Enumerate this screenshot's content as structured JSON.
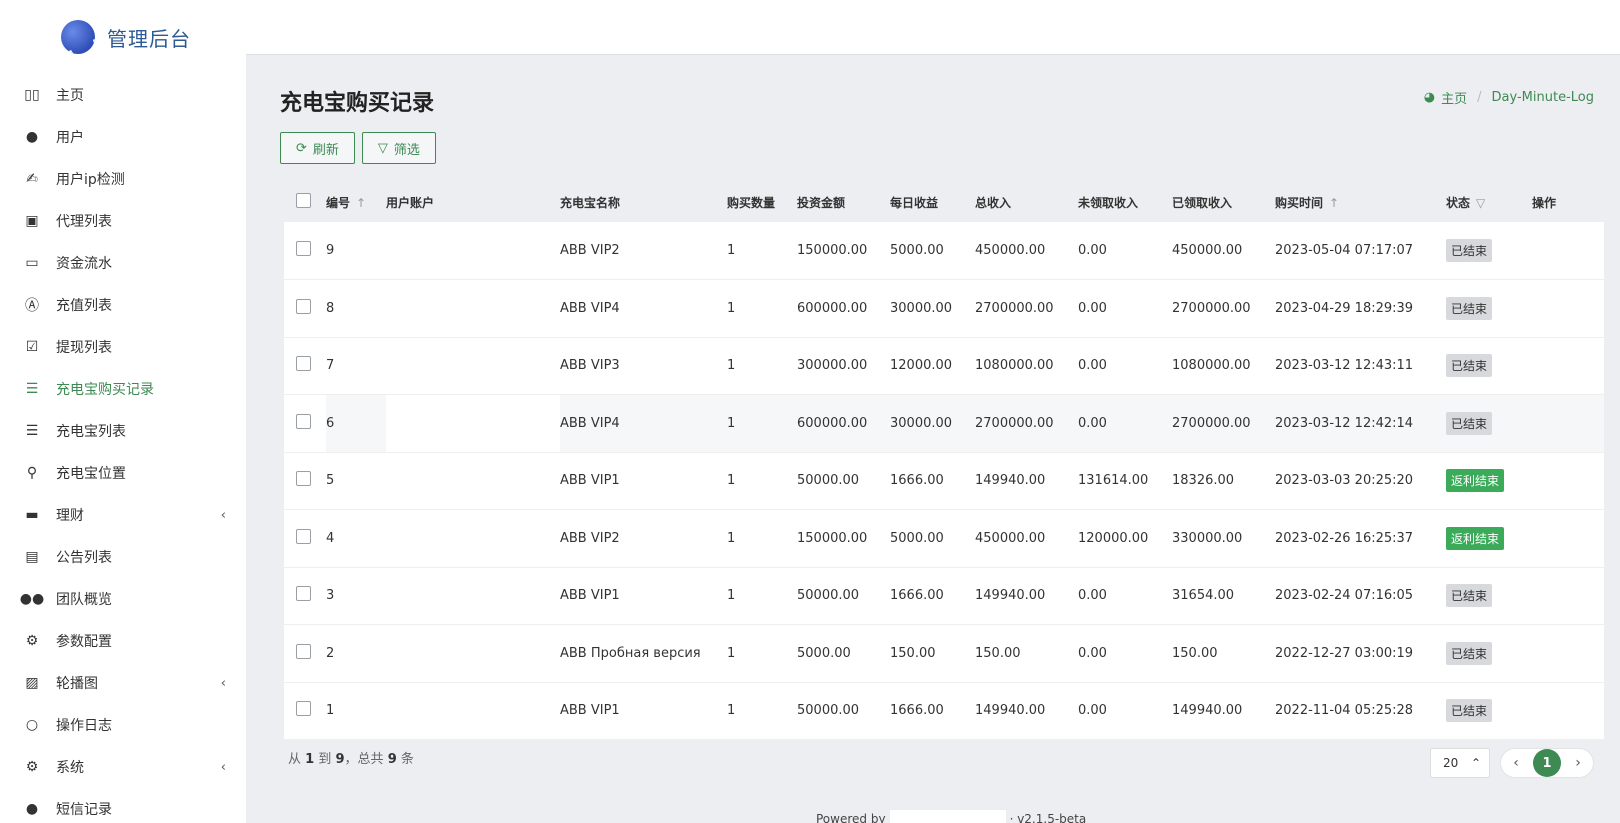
{
  "brand": {
    "title": "管理后台"
  },
  "sidebar": {
    "items": [
      {
        "label": "主页",
        "icon": "bar-chart-icon",
        "glyph": "▯▯",
        "active": false,
        "chevron": false
      },
      {
        "label": "用户",
        "icon": "user-icon",
        "glyph": "●",
        "active": false,
        "chevron": false
      },
      {
        "label": "用户ip检测",
        "icon": "signature-icon",
        "glyph": "✍",
        "active": false,
        "chevron": false
      },
      {
        "label": "代理列表",
        "icon": "contact-book-icon",
        "glyph": "▣",
        "active": false,
        "chevron": false
      },
      {
        "label": "资金流水",
        "icon": "money-icon",
        "glyph": "▭",
        "active": false,
        "chevron": false
      },
      {
        "label": "充值列表",
        "icon": "letter-a-icon",
        "glyph": "Ⓐ",
        "active": false,
        "chevron": false
      },
      {
        "label": "提现列表",
        "icon": "check-square-icon",
        "glyph": "☑",
        "active": false,
        "chevron": false
      },
      {
        "label": "充电宝购买记录",
        "icon": "list-icon",
        "glyph": "☰",
        "active": true,
        "chevron": false
      },
      {
        "label": "充电宝列表",
        "icon": "indent-icon",
        "glyph": "☰",
        "active": false,
        "chevron": false
      },
      {
        "label": "充电宝位置",
        "icon": "map-marker-icon",
        "glyph": "⚲",
        "active": false,
        "chevron": false
      },
      {
        "label": "理财",
        "icon": "archive-icon",
        "glyph": "▬",
        "active": false,
        "chevron": true
      },
      {
        "label": "公告列表",
        "icon": "file-text-icon",
        "glyph": "▤",
        "active": false,
        "chevron": false
      },
      {
        "label": "团队概览",
        "icon": "users-icon",
        "glyph": "●●",
        "active": false,
        "chevron": false
      },
      {
        "label": "参数配置",
        "icon": "cogs-icon",
        "glyph": "⚙",
        "active": false,
        "chevron": false
      },
      {
        "label": "轮播图",
        "icon": "image-icon",
        "glyph": "▨",
        "active": false,
        "chevron": true
      },
      {
        "label": "操作日志",
        "icon": "circle-icon",
        "glyph": "○",
        "active": false,
        "chevron": false
      },
      {
        "label": "系统",
        "icon": "gear-icon",
        "glyph": "⚙",
        "active": false,
        "chevron": true
      },
      {
        "label": "短信记录",
        "icon": "comment-icon",
        "glyph": "●",
        "active": false,
        "chevron": false
      }
    ],
    "chevron_glyph": "‹"
  },
  "page": {
    "title": "充电宝购买记录",
    "breadcrumb_home": "主页",
    "breadcrumb_current": "Day-Minute-Log",
    "refresh_label": "刷新",
    "filter_label": "筛选"
  },
  "table": {
    "headers": {
      "id": "编号",
      "account": "用户账户",
      "name": "充电宝名称",
      "qty": "购买数量",
      "invest": "投资金额",
      "daily": "每日收益",
      "total": "总收入",
      "unclaimed": "未领取收入",
      "claimed": "已领取收入",
      "time": "购买时间",
      "status": "状态",
      "ops": "操作"
    },
    "sort_glyph": "↑",
    "filter_glyph": "▽",
    "rows": [
      {
        "id": "9",
        "name": "ABB VIP2",
        "qty": "1",
        "invest": "150000.00",
        "daily": "5000.00",
        "total": "450000.00",
        "unclaimed": "0.00",
        "claimed": "450000.00",
        "time": "2023-05-04 07:17:07",
        "status": "已结束",
        "status_type": "ended"
      },
      {
        "id": "8",
        "name": "ABB VIP4",
        "qty": "1",
        "invest": "600000.00",
        "daily": "30000.00",
        "total": "2700000.00",
        "unclaimed": "0.00",
        "claimed": "2700000.00",
        "time": "2023-04-29 18:29:39",
        "status": "已结束",
        "status_type": "ended"
      },
      {
        "id": "7",
        "name": "ABB VIP3",
        "qty": "1",
        "invest": "300000.00",
        "daily": "12000.00",
        "total": "1080000.00",
        "unclaimed": "0.00",
        "claimed": "1080000.00",
        "time": "2023-03-12 12:43:11",
        "status": "已结束",
        "status_type": "ended"
      },
      {
        "id": "6",
        "name": "ABB VIP4",
        "qty": "1",
        "invest": "600000.00",
        "daily": "30000.00",
        "total": "2700000.00",
        "unclaimed": "0.00",
        "claimed": "2700000.00",
        "time": "2023-03-12 12:42:14",
        "status": "已结束",
        "status_type": "ended"
      },
      {
        "id": "5",
        "name": "ABB VIP1",
        "qty": "1",
        "invest": "50000.00",
        "daily": "1666.00",
        "total": "149940.00",
        "unclaimed": "131614.00",
        "claimed": "18326.00",
        "time": "2023-03-03 20:25:20",
        "status": "返利结束",
        "status_type": "rebate"
      },
      {
        "id": "4",
        "name": "ABB VIP2",
        "qty": "1",
        "invest": "150000.00",
        "daily": "5000.00",
        "total": "450000.00",
        "unclaimed": "120000.00",
        "claimed": "330000.00",
        "time": "2023-02-26 16:25:37",
        "status": "返利结束",
        "status_type": "rebate"
      },
      {
        "id": "3",
        "name": "ABB VIP1",
        "qty": "1",
        "invest": "50000.00",
        "daily": "1666.00",
        "total": "149940.00",
        "unclaimed": "0.00",
        "claimed": "31654.00",
        "time": "2023-02-24 07:16:05",
        "status": "已结束",
        "status_type": "ended"
      },
      {
        "id": "2",
        "name": "ABB Пробная версия",
        "qty": "1",
        "invest": "5000.00",
        "daily": "150.00",
        "total": "150.00",
        "unclaimed": "0.00",
        "claimed": "150.00",
        "time": "2022-12-27 03:00:19",
        "status": "已结束",
        "status_type": "ended"
      },
      {
        "id": "1",
        "name": "ABB VIP1",
        "qty": "1",
        "invest": "50000.00",
        "daily": "1666.00",
        "total": "149940.00",
        "unclaimed": "0.00",
        "claimed": "149940.00",
        "time": "2022-11-04 05:25:28",
        "status": "已结束",
        "status_type": "ended"
      }
    ]
  },
  "pagination": {
    "summary_prefix": "从",
    "from": "1",
    "to_word": "到",
    "to": "9",
    "total_prefix": "，总共",
    "total": "9",
    "total_suffix": "条",
    "page_size": "20",
    "page_size_glyph": "⌃",
    "prev_glyph": "‹",
    "current_page": "1",
    "next_glyph": "›"
  },
  "footer": {
    "powered_by": "Powered by",
    "version": "· v2.1.5-beta"
  },
  "colors": {
    "accent": "#3d8a52",
    "rebate_badge": "#3bab5a",
    "ended_badge": "#d7d9dc",
    "content_bg": "#edeef1"
  }
}
